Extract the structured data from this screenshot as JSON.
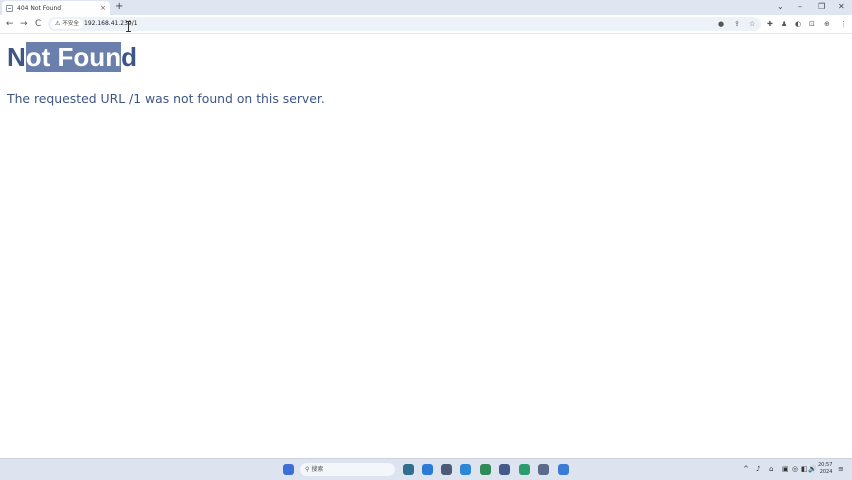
{
  "browser": {
    "tab": {
      "title": "404 Not Found",
      "close_glyph": "×"
    },
    "new_tab_glyph": "+",
    "window_controls": {
      "dropdown": "⌄",
      "minimize": "–",
      "restore": "❐",
      "close": "✕"
    },
    "nav": {
      "back": "←",
      "forward": "→",
      "reload": "C"
    },
    "security_label": "不安全",
    "security_glyph": "⚠",
    "url": "192.168.41.239/1",
    "toolbar_icons": [
      "●",
      "⇪",
      "☆",
      "✚",
      "♟",
      "◐",
      "⊡",
      "⊕",
      "⋮"
    ]
  },
  "page": {
    "heading_unselected_start": "N",
    "heading_selected": "ot Foun",
    "heading_unselected_end": "d",
    "message": "The requested URL /1 was not found on this server."
  },
  "taskbar": {
    "search_label": "搜索",
    "search_glyph": "⚲",
    "tray_icons": [
      "^",
      "♪",
      "⌂",
      "▣",
      "◎",
      "◧",
      "🔊",
      "≡"
    ],
    "clock_time": "20:57",
    "clock_date": "2024",
    "colors": {
      "start": "#3d6fd6",
      "apps": [
        "#2f6e8e",
        "#2b7bd4",
        "#4b5b78",
        "#2d86d6",
        "#2e8b57",
        "#455a8c",
        "#2a9d6e",
        "#5a6a8a",
        "#3a7bd5"
      ]
    }
  }
}
